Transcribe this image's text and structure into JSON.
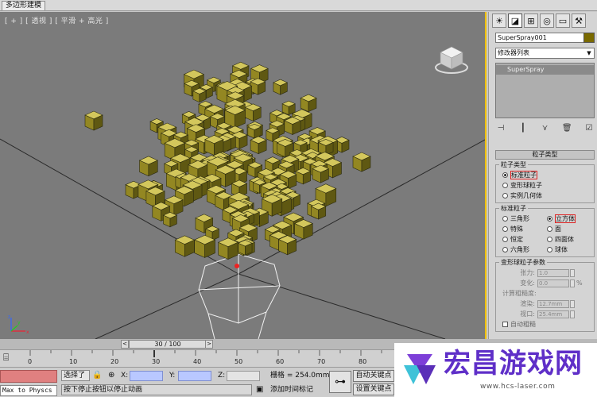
{
  "ribbon": {
    "tab_label": "多边形建模"
  },
  "viewport": {
    "label": "[ + ] [ 透视 ] [ 平滑 + 高光 ]",
    "axis_labels": [
      "x",
      "y",
      "z"
    ]
  },
  "command_panel": {
    "tabs": [
      "create-icon",
      "modify-icon",
      "hierarchy-icon",
      "motion-icon",
      "display-icon",
      "utilities-icon"
    ],
    "object_name": "SuperSpray001",
    "object_color": "#7a6a00",
    "modifier_list": "修改器列表",
    "stack_items": [
      "SuperSpray"
    ],
    "rollout_title": "粒子类型",
    "particle_types": {
      "title": "粒子类型",
      "options": [
        {
          "label": "标准粒子",
          "selected": true,
          "highlighted": true
        },
        {
          "label": "变形球粒子",
          "selected": false
        },
        {
          "label": "实例几何体",
          "selected": false
        }
      ]
    },
    "standard_particles": {
      "title": "标准粒子",
      "options": [
        {
          "label": "三角形",
          "selected": false
        },
        {
          "label": "立方体",
          "selected": true,
          "highlighted": true
        },
        {
          "label": "特殊",
          "selected": false
        },
        {
          "label": "面",
          "selected": false
        },
        {
          "label": "恒定",
          "selected": false
        },
        {
          "label": "四面体",
          "selected": false
        },
        {
          "label": "六角形",
          "selected": false
        },
        {
          "label": "球体",
          "selected": false
        }
      ]
    },
    "metaball": {
      "title": "变形球粒子参数",
      "tension_label": "张力:",
      "tension_value": "1.0",
      "variation_label": "变化:",
      "variation_value": "0.0",
      "variation_unit": "%",
      "coarseness_label": "计算粗糙度:",
      "render_label": "渲染:",
      "render_value": "12.7mm",
      "viewport_label": "视口:",
      "viewport_value": "25.4mm",
      "auto_label": "自动粗糙"
    }
  },
  "timeline": {
    "frame_display": "30 / 100",
    "current_frame": 30,
    "total_frames": 100,
    "ticks": [
      "0",
      "10",
      "20",
      "30",
      "40",
      "50",
      "60",
      "70",
      "80"
    ]
  },
  "status": {
    "maxscript": "Max to Physcs C",
    "selection": "选择了",
    "prompt": "按下停止按钮以停止动画",
    "x_label": "X:",
    "y_label": "Y:",
    "z_label": "Z:",
    "grid": "栅格 = 254.0mm",
    "add_time_tag": "添加时间标记",
    "auto_key": "自动关键点",
    "set_key": "设置关键点"
  },
  "watermark": {
    "title": "宏昌游戏网",
    "url": "www.hcs-laser.com"
  }
}
